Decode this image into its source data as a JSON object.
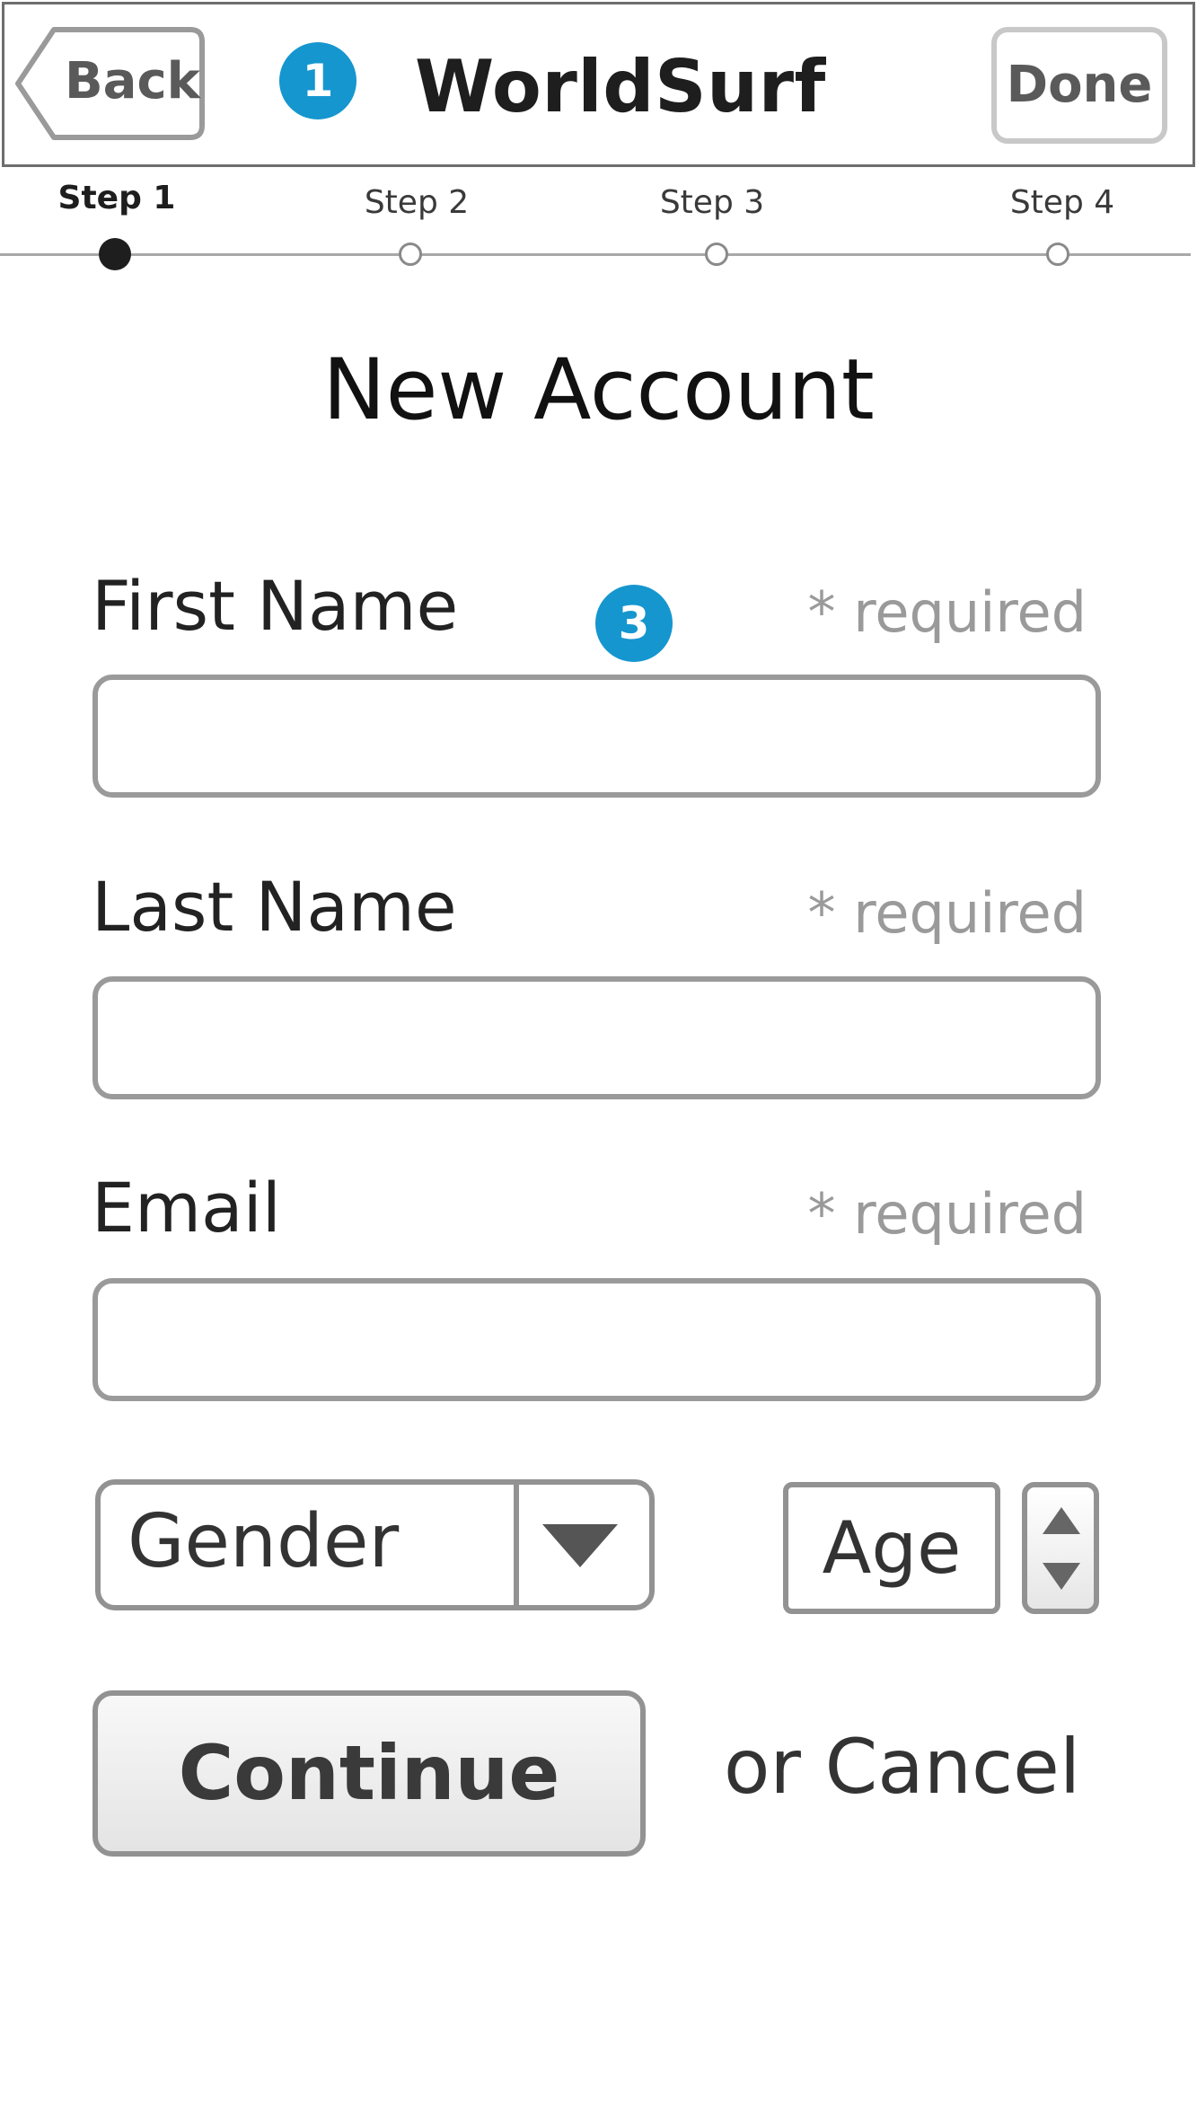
{
  "header": {
    "back_label": "Back",
    "badge_one": "1",
    "title": "WorldSurf",
    "done_label": "Done"
  },
  "stepper": {
    "steps": [
      "Step 1",
      "Step 2",
      "Step 3",
      "Step 4"
    ],
    "active_index": 0
  },
  "page_title": "New Account",
  "annotation_badge": "3",
  "form": {
    "required_text": "* required",
    "first_name": {
      "label": "First Name",
      "value": ""
    },
    "last_name": {
      "label": "Last Name",
      "value": ""
    },
    "email": {
      "label": "Email",
      "value": ""
    },
    "gender": {
      "value": "Gender"
    },
    "age": {
      "value": "Age"
    }
  },
  "actions": {
    "continue_label": "Continue",
    "cancel_label": "or Cancel"
  },
  "colors": {
    "badge": "#1596cf",
    "border": "#929292",
    "required": "#9a9a9a"
  },
  "icons": {
    "back": "back-arrow-button-shape",
    "select": "chevron-down-icon",
    "stepper": "up-down-spinner-icon"
  }
}
